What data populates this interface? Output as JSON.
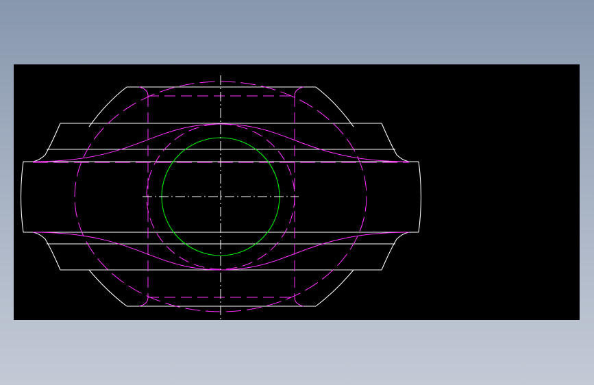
{
  "colors": {
    "background_gradient_top": "#8797ad",
    "background_gradient_bottom": "#c3cad6",
    "viewport_background": "#000000",
    "outline": "#ffffff",
    "hidden_lines": "#ff33ff",
    "circle": "#00ee00",
    "centerline": "#ffffff"
  },
  "drawing": {
    "views": [
      "front-view"
    ],
    "line_types": [
      "continuous-outline",
      "dashed-hidden",
      "dash-dot-centerline"
    ]
  }
}
